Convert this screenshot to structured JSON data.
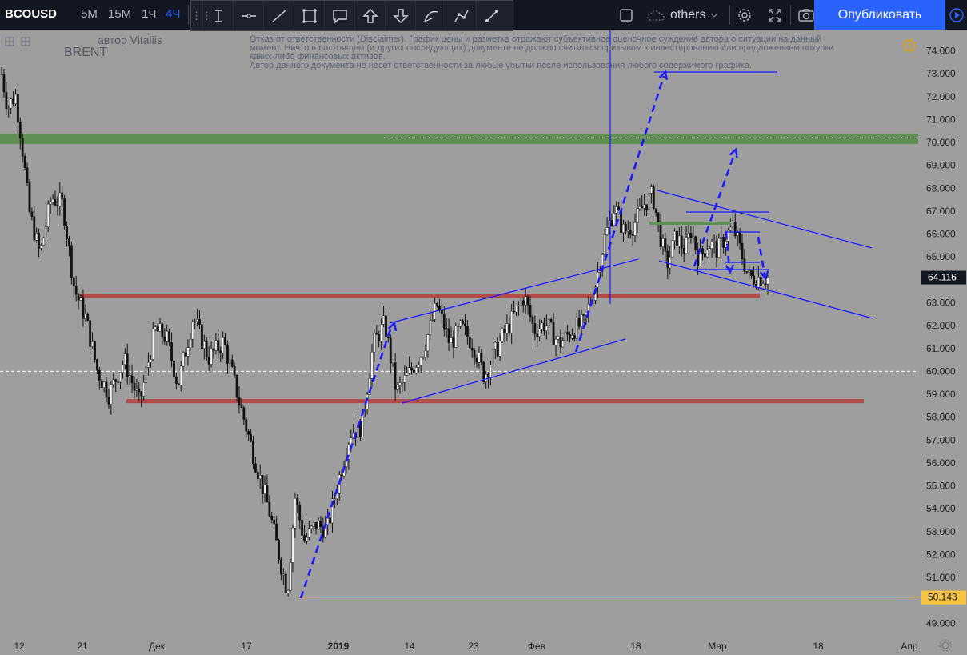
{
  "toolbar": {
    "symbol": "BCOUSD",
    "timeframes": [
      "5M",
      "15M",
      "1Ч",
      "4Ч"
    ],
    "active_timeframe": "4Ч",
    "others_label": "others",
    "publish_label": "Опубликовать"
  },
  "drawing_tools": [
    "cursor-tool",
    "horizontal-line",
    "trend-line",
    "rectangle",
    "callout",
    "arrow-up",
    "arrow-down",
    "curve",
    "path",
    "brush"
  ],
  "overlay": {
    "author": "автор Vitaliis",
    "symbol_note": "BRENT",
    "disclaimer": [
      "Отказ от ответственности (Disclaimer). График цены и разметка отражают субъективное оценочное суждение автора о ситуации на данный",
      "момент. Ничто в настоящем (и других последующих) документе не должно считаться призывом к инвестированию или предложением покупки",
      "каких-либо финансовых активов.",
      "Автор данного документа не несет ответственности за любые убытки после использования любого содержимого графика."
    ]
  },
  "colors": {
    "background": "#9e9e9e",
    "toolbar": "#131722",
    "accent": "#2962ff",
    "drawing_blue": "#1a1aff",
    "support_red": "#b24a4a",
    "zone_green": "#5f8f52",
    "label_dark": "#131722",
    "label_yellow": "#f5c542"
  },
  "chart_data": {
    "type": "candlestick",
    "ylim": [
      48.6,
      75.0
    ],
    "y_ticks": [
      "74.000",
      "73.000",
      "72.000",
      "71.000",
      "70.000",
      "69.000",
      "68.000",
      "67.000",
      "66.000",
      "65.000",
      "64.000",
      "63.000",
      "62.000",
      "61.000",
      "60.000",
      "59.000",
      "58.000",
      "57.000",
      "56.000",
      "55.000",
      "54.000",
      "53.000",
      "52.000",
      "51.000",
      "50.000",
      "49.000"
    ],
    "x_ticks": [
      "12",
      "21",
      "Дек",
      "17",
      "2019",
      "14",
      "23",
      "Фев",
      "18",
      "Мар",
      "18",
      "Апр"
    ],
    "price_labels": [
      {
        "value": 64.116,
        "text": "64.116",
        "style": "dark"
      },
      {
        "value": 50.143,
        "text": "50.143",
        "style": "yellow"
      }
    ],
    "path": [
      [
        0,
        73.0
      ],
      [
        0.008,
        71.5
      ],
      [
        0.018,
        72.1
      ],
      [
        0.026,
        70.1
      ],
      [
        0.036,
        67.0
      ],
      [
        0.05,
        65.1
      ],
      [
        0.065,
        67.6
      ],
      [
        0.08,
        67.3
      ],
      [
        0.095,
        63.6
      ],
      [
        0.11,
        62.3
      ],
      [
        0.125,
        60.0
      ],
      [
        0.14,
        59.0
      ],
      [
        0.16,
        60.5
      ],
      [
        0.18,
        58.6
      ],
      [
        0.2,
        61.8
      ],
      [
        0.215,
        61.5
      ],
      [
        0.23,
        59.4
      ],
      [
        0.25,
        62.4
      ],
      [
        0.27,
        60.6
      ],
      [
        0.29,
        61.3
      ],
      [
        0.31,
        58.7
      ],
      [
        0.33,
        56.2
      ],
      [
        0.35,
        53.8
      ],
      [
        0.365,
        51.5
      ],
      [
        0.373,
        50.4
      ],
      [
        0.383,
        54.5
      ],
      [
        0.395,
        52.6
      ],
      [
        0.41,
        53.3
      ],
      [
        0.425,
        53.1
      ],
      [
        0.44,
        55.3
      ],
      [
        0.455,
        57.3
      ],
      [
        0.47,
        57.6
      ],
      [
        0.485,
        61.2
      ],
      [
        0.5,
        62.1
      ],
      [
        0.515,
        59.1
      ],
      [
        0.53,
        59.8
      ],
      [
        0.55,
        60.9
      ],
      [
        0.568,
        62.9
      ],
      [
        0.585,
        61.2
      ],
      [
        0.6,
        61.9
      ],
      [
        0.615,
        61.2
      ],
      [
        0.63,
        59.8
      ],
      [
        0.648,
        61.1
      ],
      [
        0.665,
        62.2
      ],
      [
        0.682,
        63.3
      ],
      [
        0.695,
        61.8
      ],
      [
        0.71,
        62.1
      ],
      [
        0.728,
        61.2
      ],
      [
        0.745,
        61.8
      ],
      [
        0.76,
        62.1
      ],
      [
        0.775,
        63.8
      ],
      [
        0.787,
        65.8
      ],
      [
        0.8,
        67.2
      ],
      [
        0.812,
        66.1
      ],
      [
        0.825,
        66.4
      ],
      [
        0.84,
        67.4
      ],
      [
        0.85,
        67.7
      ],
      [
        0.858,
        66.2
      ],
      [
        0.868,
        64.6
      ],
      [
        0.88,
        65.9
      ],
      [
        0.892,
        65.3
      ],
      [
        0.9,
        66.2
      ],
      [
        0.91,
        64.9
      ],
      [
        0.922,
        65.6
      ],
      [
        0.935,
        65.3
      ],
      [
        0.945,
        65.9
      ],
      [
        0.955,
        66.3
      ],
      [
        0.965,
        65.2
      ],
      [
        0.975,
        64.1
      ]
    ],
    "levels": [
      {
        "type": "zone",
        "color": "green",
        "from": 69.93,
        "to": 70.37
      },
      {
        "type": "line",
        "color": "white-dashed",
        "value": 70.2
      },
      {
        "type": "line",
        "color": "white-dashed",
        "value": 60.0
      },
      {
        "type": "line",
        "color": "red",
        "value": 63.3
      },
      {
        "type": "line",
        "color": "red",
        "value": 58.7
      },
      {
        "type": "line",
        "color": "yellow",
        "value": 50.143
      }
    ]
  }
}
